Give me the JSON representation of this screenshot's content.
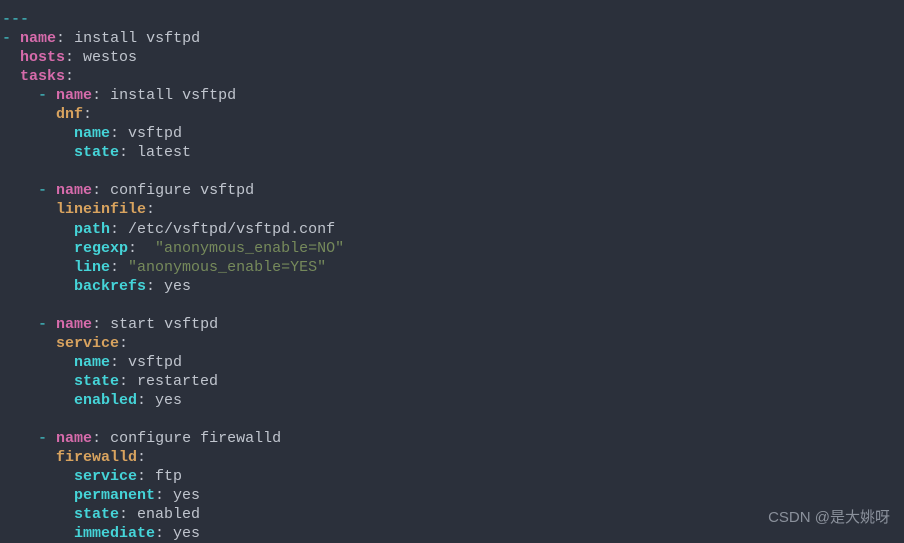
{
  "doc_start": "---",
  "play": {
    "name_key": "name",
    "name_val": "install vsftpd",
    "hosts_key": "hosts",
    "hosts_val": "westos",
    "tasks_key": "tasks"
  },
  "task1": {
    "name_key": "name",
    "name_val": "install vsftpd",
    "mod_key": "dnf",
    "p1_key": "name",
    "p1_val": "vsftpd",
    "p2_key": "state",
    "p2_val": "latest"
  },
  "task2": {
    "name_key": "name",
    "name_val": "configure vsftpd",
    "mod_key": "lineinfile",
    "p1_key": "path",
    "p1_val": "/etc/vsftpd/vsftpd.conf",
    "p2_key": "regexp",
    "p2_val": "\"anonymous_enable=NO\"",
    "p3_key": "line",
    "p3_val": "\"anonymous_enable=YES\"",
    "p4_key": "backrefs",
    "p4_val": "yes"
  },
  "task3": {
    "name_key": "name",
    "name_val": "start vsftpd",
    "mod_key": "service",
    "p1_key": "name",
    "p1_val": "vsftpd",
    "p2_key": "state",
    "p2_val": "restarted",
    "p3_key": "enabled",
    "p3_val": "yes"
  },
  "task4": {
    "name_key": "name",
    "name_val": "configure firewalld",
    "mod_key": "firewalld",
    "p1_key": "service",
    "p1_val": "ftp",
    "p2_key": "permanent",
    "p2_val": "yes",
    "p3_key": "state",
    "p3_val": "enabled",
    "p4_key": "immediate",
    "p4_val": "yes"
  },
  "watermark": "CSDN @是大姚呀"
}
